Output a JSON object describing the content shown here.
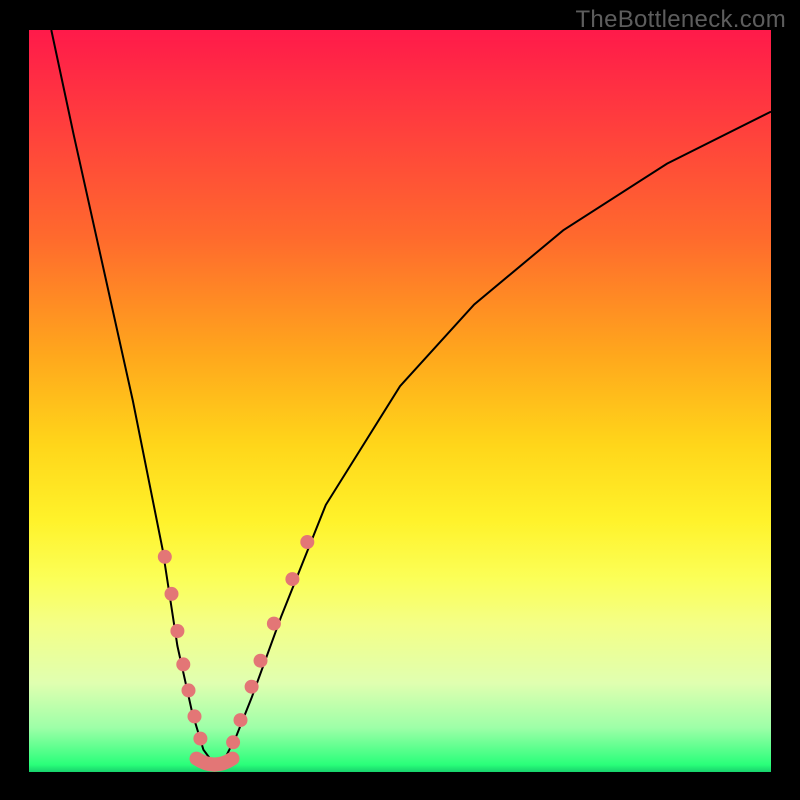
{
  "watermark": "TheBottleneck.com",
  "colors": {
    "background": "#000000",
    "gradient_top": "#ff1a4a",
    "gradient_bottom": "#17d26c",
    "curve": "#000000",
    "markers": "#e37676"
  },
  "chart_data": {
    "type": "line",
    "title": "",
    "xlabel": "",
    "ylabel": "",
    "xlim": [
      0,
      100
    ],
    "ylim": [
      0,
      100
    ],
    "annotations": [
      "TheBottleneck.com"
    ],
    "grid": false,
    "series": [
      {
        "name": "bottleneck-curve",
        "x": [
          3,
          6,
          10,
          14,
          18,
          20,
          22,
          23.5,
          25,
          26.5,
          28,
          30,
          34,
          40,
          50,
          60,
          72,
          86,
          100
        ],
        "values": [
          100,
          86,
          68,
          50,
          30,
          17,
          8,
          3,
          1,
          2,
          5,
          10,
          21,
          36,
          52,
          63,
          73,
          82,
          89
        ]
      }
    ],
    "markers": {
      "left_branch": [
        {
          "x": 18.3,
          "y": 29
        },
        {
          "x": 19.2,
          "y": 24
        },
        {
          "x": 20.0,
          "y": 19
        },
        {
          "x": 20.8,
          "y": 14.5
        },
        {
          "x": 21.5,
          "y": 11
        },
        {
          "x": 22.3,
          "y": 7.5
        },
        {
          "x": 23.1,
          "y": 4.5
        }
      ],
      "right_branch": [
        {
          "x": 27.5,
          "y": 4
        },
        {
          "x": 28.5,
          "y": 7
        },
        {
          "x": 30.0,
          "y": 11.5
        },
        {
          "x": 31.2,
          "y": 15
        },
        {
          "x": 33.0,
          "y": 20
        },
        {
          "x": 35.5,
          "y": 26
        },
        {
          "x": 37.5,
          "y": 31
        }
      ],
      "valley_center": {
        "x": 25,
        "y": 1
      }
    }
  }
}
